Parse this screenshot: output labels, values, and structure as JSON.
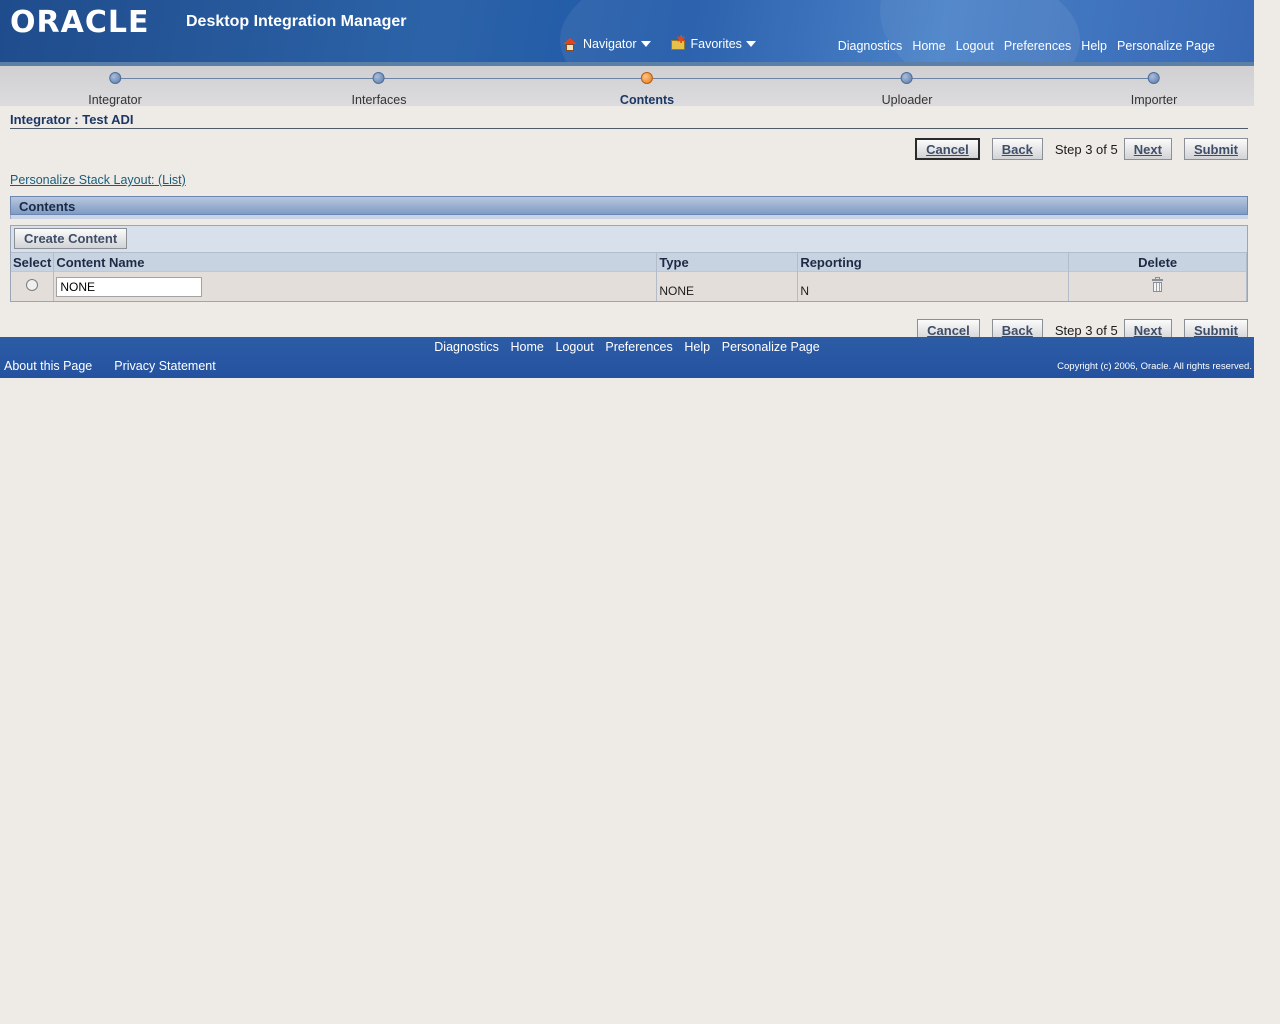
{
  "header": {
    "logo": "ORACLE",
    "app_title": "Desktop Integration Manager",
    "menus": [
      {
        "label": "Navigator",
        "icon": "home-icon"
      },
      {
        "label": "Favorites",
        "icon": "favorites-folder-icon"
      }
    ],
    "global_links": [
      "Diagnostics",
      "Home",
      "Logout",
      "Preferences",
      "Help",
      "Personalize Page"
    ]
  },
  "train": {
    "steps": [
      "Integrator",
      "Interfaces",
      "Contents",
      "Uploader",
      "Importer"
    ],
    "current_index": 2
  },
  "page": {
    "heading": "Integrator : Test ADI",
    "personalize_link": "Personalize Stack Layout: (List)"
  },
  "nav_buttons": {
    "cancel": "Cancel",
    "back": "Back",
    "step_info": "Step 3 of 5",
    "next": "Next",
    "submit": "Submit"
  },
  "section": {
    "title": "Contents",
    "create_button": "Create Content",
    "columns": {
      "select": "Select",
      "content_name": "Content Name",
      "type": "Type",
      "reporting": "Reporting",
      "delete": "Delete"
    },
    "rows": [
      {
        "content_name": "NONE",
        "type": "NONE",
        "reporting": "N"
      }
    ]
  },
  "footer": {
    "links": [
      "Diagnostics",
      "Home",
      "Logout",
      "Preferences",
      "Help",
      "Personalize Page"
    ],
    "about": "About this Page",
    "privacy": "Privacy Statement",
    "copyright": "Copyright (c) 2006, Oracle. All rights reserved."
  },
  "colors": {
    "header_blue": "#2452a0",
    "current_step": "#e27a14",
    "section_header": "#7f9bc4"
  }
}
